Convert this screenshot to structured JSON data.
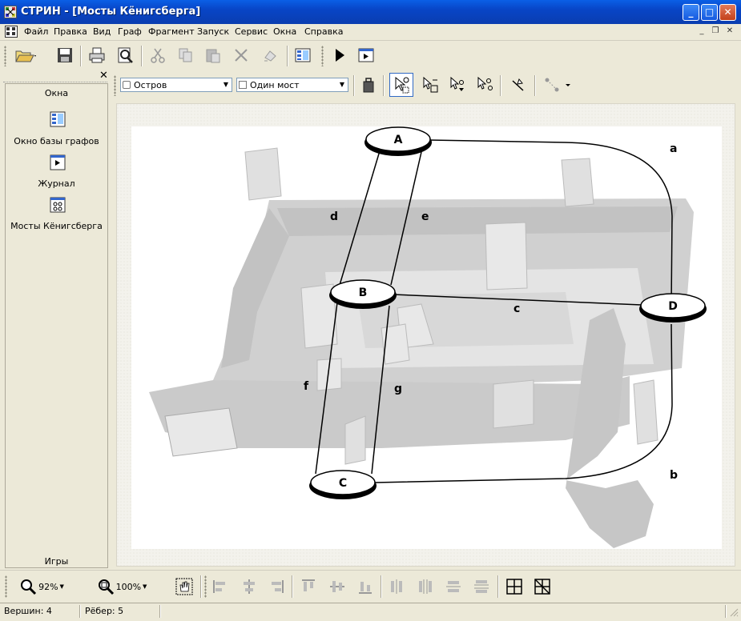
{
  "window": {
    "title": "СТРИН - [Мосты Кёнигсберга]"
  },
  "menu": {
    "items": [
      "Файл",
      "Правка",
      "Вид",
      "Граф",
      "Фрагмент",
      "Запуск",
      "Сервис",
      "Окна",
      "Справка"
    ]
  },
  "main_toolbar": {
    "buttons": [
      "open-icon",
      "save-icon",
      "print-icon",
      "print-preview-icon",
      "cut-icon",
      "copy-icon",
      "paste-icon",
      "delete-icon",
      "undo-icon",
      "graph-db-icon",
      "run-icon",
      "journal-icon"
    ]
  },
  "left_panel": {
    "section_top": "Окна",
    "items": [
      {
        "label": "Окно базы графов",
        "icon": "graph-db-window-icon"
      },
      {
        "label": "Журнал",
        "icon": "journal-icon"
      },
      {
        "label": "Мосты Кёнигсберга",
        "icon": "graph-document-icon"
      }
    ],
    "section_bottom": "Игры"
  },
  "graph_toolbar": {
    "vertex_type": "Остров",
    "edge_type": "Один мост"
  },
  "graph": {
    "vertices": [
      {
        "id": "A",
        "label": "A"
      },
      {
        "id": "B",
        "label": "B"
      },
      {
        "id": "C",
        "label": "C"
      },
      {
        "id": "D",
        "label": "D"
      }
    ],
    "edges": [
      {
        "label": "a",
        "from": "A",
        "to": "D"
      },
      {
        "label": "b",
        "from": "C",
        "to": "D"
      },
      {
        "label": "c",
        "from": "B",
        "to": "D"
      },
      {
        "label": "d",
        "from": "A",
        "to": "B"
      },
      {
        "label": "e",
        "from": "A",
        "to": "B"
      },
      {
        "label": "f",
        "from": "B",
        "to": "C"
      },
      {
        "label": "g",
        "from": "B",
        "to": "C"
      }
    ]
  },
  "bottom_toolbar": {
    "zoom_value": "92%",
    "zoom_fit_value": "100%"
  },
  "status": {
    "vertices": "Вершин: 4",
    "edges": "Рёбер: 5"
  },
  "colors": {
    "titlebar": "#0a5fe6",
    "chrome": "#ece9d8",
    "canvas": "#faf9f5",
    "map_gray": "#c8c8c8"
  }
}
